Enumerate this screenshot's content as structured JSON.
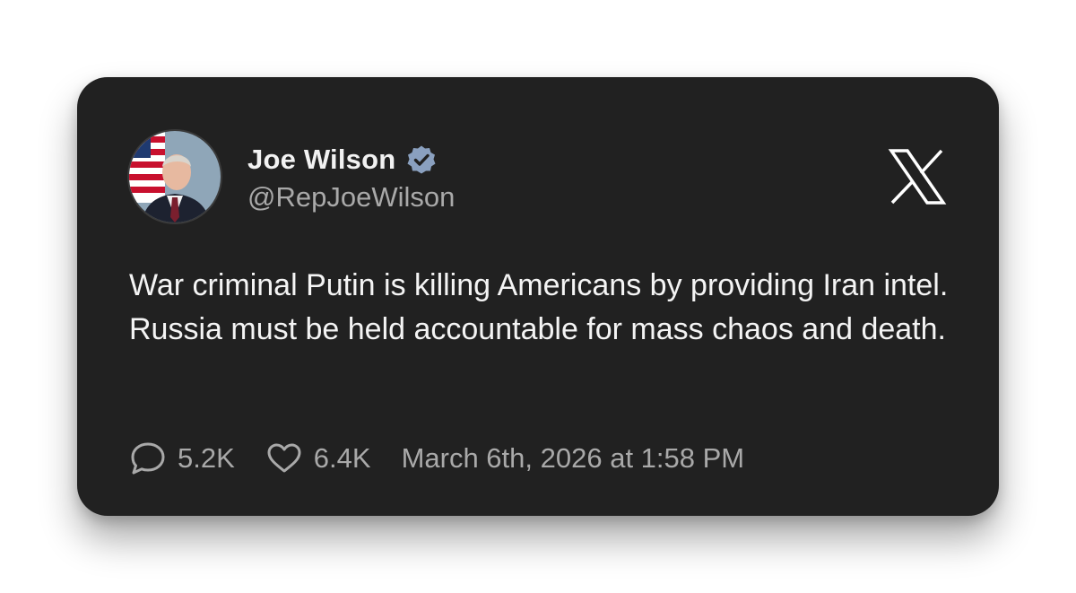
{
  "author": {
    "name": "Joe Wilson",
    "handle": "@RepJoeWilson",
    "verified": true,
    "verified_badge_color": "#8aa0bf"
  },
  "platform_logo": "x-logo-icon",
  "tweet": {
    "text": "War criminal Putin is killing Americans by providing Iran intel. Russia must be held accountable for mass chaos and death."
  },
  "stats": {
    "replies": "5.2K",
    "likes": "6.4K"
  },
  "timestamp": "March 6th, 2026 at 1:58 PM",
  "colors": {
    "card_background": "#212121",
    "primary_text": "#f4f4f4",
    "secondary_text": "#a9a9a9"
  }
}
